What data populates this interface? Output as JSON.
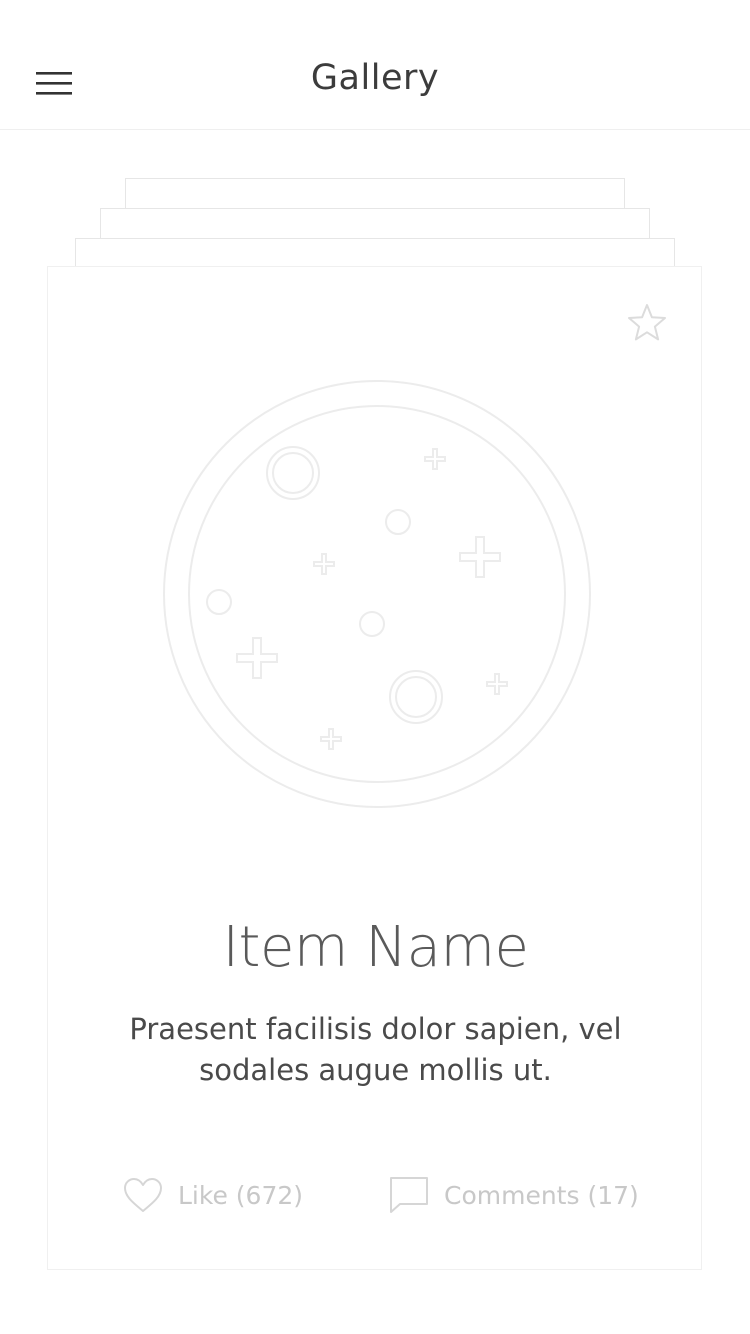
{
  "header": {
    "title": "Gallery",
    "menu_icon": "hamburger-menu-icon"
  },
  "card": {
    "favorite_icon": "star-outline-icon",
    "illustration_icon": "planet-placeholder-illustration",
    "item_name": "Item Name",
    "description": "Praesent facilisis dolor sapien, vel sodales augue mollis ut.",
    "actions": {
      "like_label": "Like (672)",
      "like_icon": "heart-outline-icon",
      "comments_label": "Comments (17)",
      "comments_icon": "speech-bubble-icon"
    }
  },
  "colors": {
    "background": "#ffffff",
    "title_text": "#3c3c3c",
    "item_name_text": "#5a5a5a",
    "muted": "#c8c8c8",
    "card_border": "#e6e6e6"
  }
}
